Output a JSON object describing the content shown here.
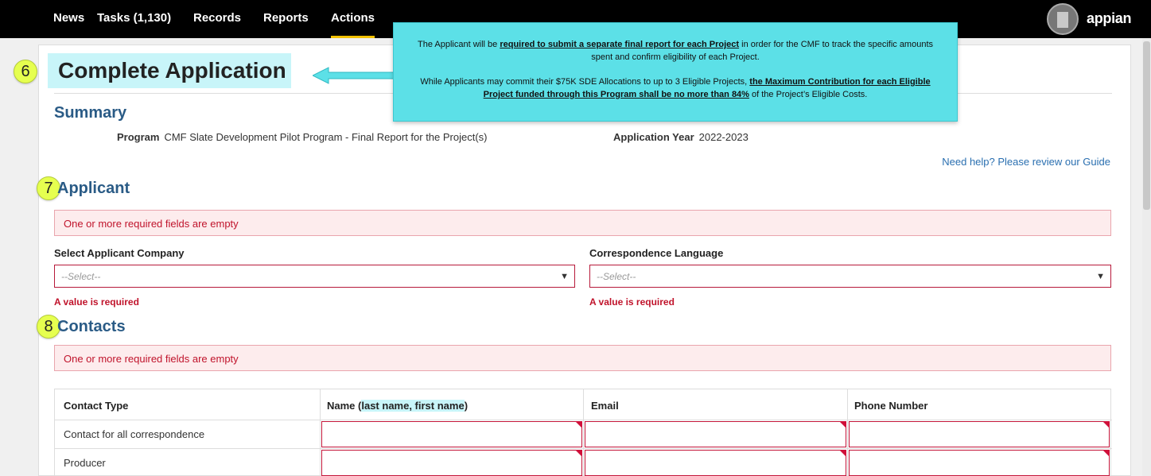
{
  "nav": {
    "items": [
      {
        "label": "News"
      },
      {
        "label": "Tasks (1,130)"
      },
      {
        "label": "Records"
      },
      {
        "label": "Reports"
      },
      {
        "label": "Actions"
      }
    ],
    "brand": "appian"
  },
  "page": {
    "title": "Complete Application"
  },
  "badges": {
    "title": "6",
    "applicant": "7",
    "contacts": "8"
  },
  "tooltip": {
    "p1_pre": "The Applicant will be ",
    "p1_strong": "required to submit a separate final report for each Project",
    "p1_post": " in order for the CMF to track the specific amounts spent and confirm eligibility of each Project.",
    "p2_pre": "While Applicants may commit their $75K SDE Allocations to up to 3 Eligible Projects, ",
    "p2_strong": "the Maximum Contribution for each Eligible Project funded through this Program shall be no more than 84%",
    "p2_post": " of the Project’s Eligible Costs."
  },
  "summary": {
    "heading": "Summary",
    "program_label": "Program",
    "program_value": "CMF Slate Development Pilot Program - Final Report for the Project(s)",
    "year_label": "Application Year",
    "year_value": "2022-2023",
    "help_link": "Need help? Please review our Guide"
  },
  "applicant": {
    "heading": "Applicant",
    "alert": "One or more required fields are empty",
    "company_label": "Select Applicant Company",
    "company_placeholder": "--Select--",
    "language_label": "Correspondence Language",
    "language_placeholder": "--Select--",
    "error": "A value is required"
  },
  "contacts": {
    "heading": "Contacts",
    "alert": "One or more required fields are empty",
    "columns": {
      "type": "Contact Type",
      "name_pre": "Name (",
      "name_hl": "last name, first name",
      "name_post": ")",
      "email": "Email",
      "phone": "Phone Number"
    },
    "rows": [
      {
        "type": "Contact for all correspondence"
      },
      {
        "type": "Producer"
      }
    ]
  }
}
